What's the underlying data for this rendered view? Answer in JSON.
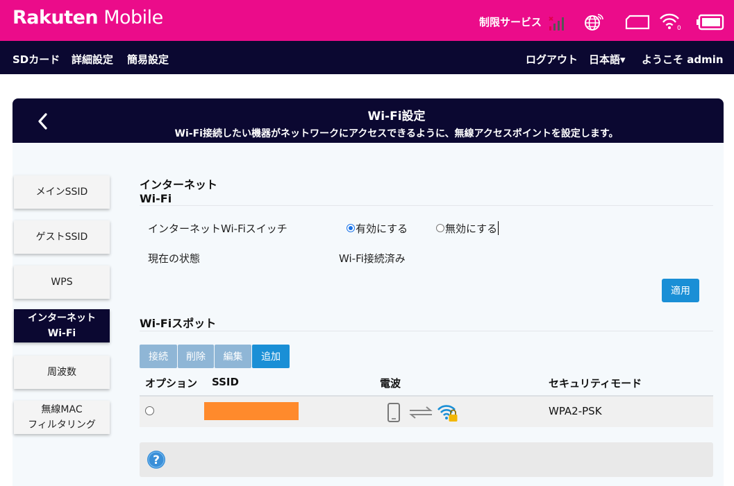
{
  "brand": {
    "logo_main": "Rakuten",
    "logo_sub": " Mobile",
    "accent": "#eb0c8a",
    "navy": "#0b0831"
  },
  "status": {
    "service_label": "制限サービス"
  },
  "nav": {
    "left": [
      "SDカード",
      "詳細設定",
      "簡易設定"
    ],
    "logout": "ログアウト",
    "language": "日本語▾",
    "welcome": "ようこそ admin"
  },
  "header": {
    "title": "Wi-Fi設定",
    "subtitle": "Wi-Fi接続したい機器がネットワークにアクセスできるように、無線アクセスポイントを設定します。"
  },
  "side_menu": [
    {
      "label1": "メインSSID",
      "label2": ""
    },
    {
      "label1": "ゲストSSID",
      "label2": ""
    },
    {
      "label1": "WPS",
      "label2": ""
    },
    {
      "label1": "インターネット",
      "label2": "Wi-Fi"
    },
    {
      "label1": "周波数",
      "label2": ""
    },
    {
      "label1": "無線MAC",
      "label2": "フィルタリング"
    }
  ],
  "internet_wifi": {
    "title_line1": "インターネット",
    "title_line2": "Wi-Fi",
    "switch_label": "インターネットWi-Fiスイッチ",
    "enable_label": "有効にする",
    "disable_label": "無効にする",
    "selected": "enable",
    "status_label": "現在の状態",
    "status_value": "Wi-Fi接続済み",
    "apply": "適用"
  },
  "spots": {
    "title": "Wi-Fiスポット",
    "buttons": {
      "connect": "接続",
      "delete": "削除",
      "edit": "編集",
      "add": "追加"
    },
    "columns": {
      "option": "オプション",
      "ssid": "SSID",
      "signal": "電波",
      "security": "セキュリティモード"
    },
    "rows": [
      {
        "security": "WPA2-PSK"
      }
    ]
  },
  "icons": [
    "signal-icon",
    "globe-icon",
    "sim-card-icon",
    "wifi-icon",
    "battery-icon",
    "back-icon",
    "phone-icon",
    "transfer-icon",
    "wifi-lock-icon",
    "help-icon"
  ]
}
